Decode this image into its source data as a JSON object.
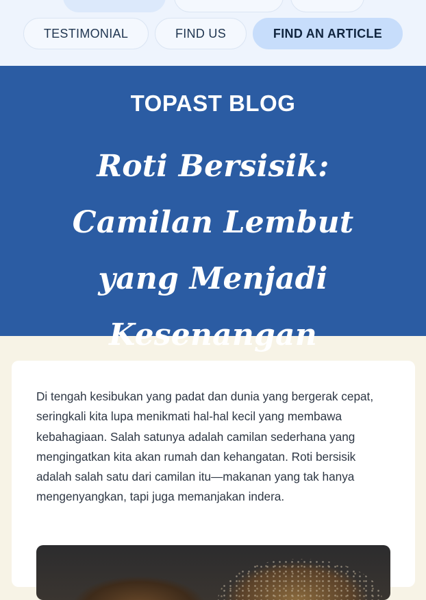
{
  "nav": {
    "items": [
      {
        "label": "TESTIMONIAL"
      },
      {
        "label": "FIND US"
      },
      {
        "label": "FIND AN ARTICLE"
      }
    ]
  },
  "hero": {
    "blog_label": "TOPAST BLOG",
    "title": "Roti Bersisik: Camilan Lembut yang Menjadi Kesenangan Sederhana"
  },
  "article": {
    "intro": "Di tengah kesibukan yang padat dan dunia yang bergerak cepat, seringkali kita lupa menikmati hal-hal kecil yang membawa kebahagiaan. Salah satunya adalah camilan sederhana yang mengingatkan kita akan rumah dan kehangatan. Roti bersisik adalah salah satu dari camilan itu—makanan yang tak hanya mengenyangkan, tapi juga memanjakan indera."
  },
  "colors": {
    "hero_bg": "#2b5ca3",
    "nav_bg": "#eef4fd",
    "active_pill": "#c7ddfb",
    "page_bg": "#f7f3e6"
  }
}
